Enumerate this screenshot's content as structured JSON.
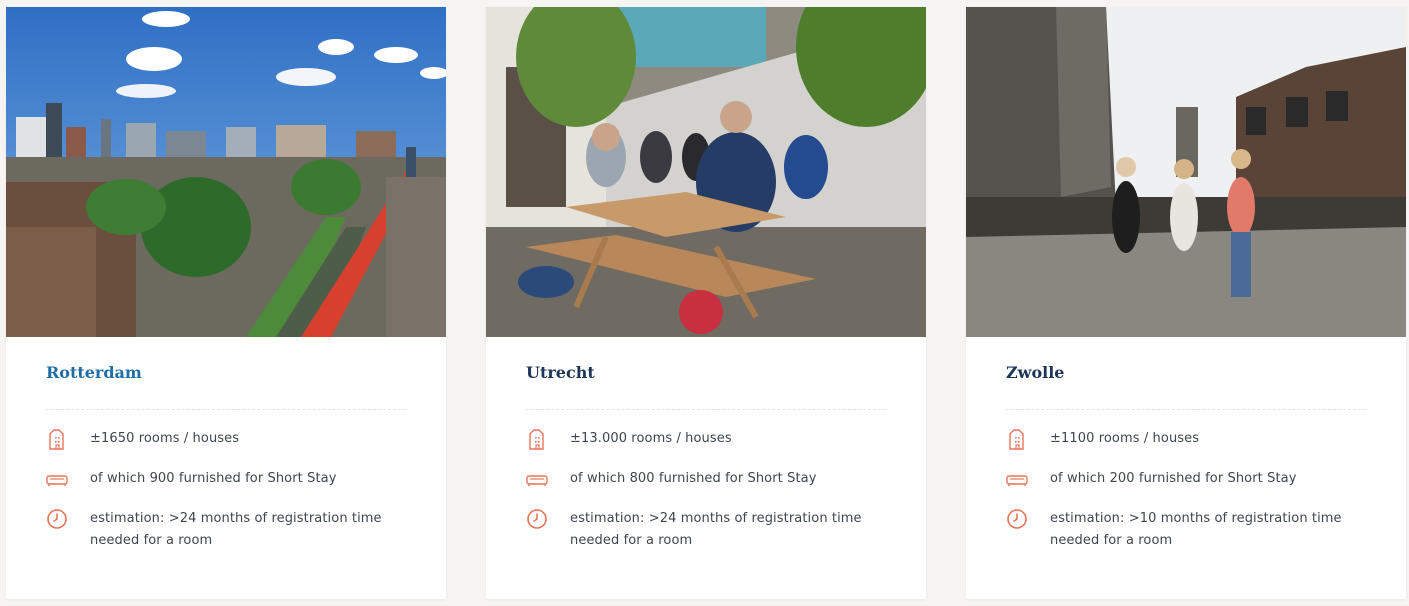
{
  "colors": {
    "accent": "#e8745a",
    "title": "#1d3556",
    "link_hover": "#1f6ea6"
  },
  "cities": [
    {
      "name": "Rotterdam",
      "photo_alt": "Rotterdam",
      "features": [
        {
          "icon": "building-icon",
          "text": "±1650 rooms / houses"
        },
        {
          "icon": "sofa-icon",
          "text": "of which 900 furnished for Short Stay"
        },
        {
          "icon": "clock-icon",
          "text": "estimation: >24 months of registration time needed for a room"
        }
      ]
    },
    {
      "name": "Utrecht",
      "photo_alt": "Utrecht",
      "features": [
        {
          "icon": "building-icon",
          "text": "±13.000 rooms / houses"
        },
        {
          "icon": "sofa-icon",
          "text": "of which 800 furnished for Short Stay"
        },
        {
          "icon": "clock-icon",
          "text": "estimation: >24 months of registration time needed for a room"
        }
      ]
    },
    {
      "name": "Zwolle",
      "photo_alt": "Zwolle",
      "features": [
        {
          "icon": "building-icon",
          "text": "±1100 rooms / houses"
        },
        {
          "icon": "sofa-icon",
          "text": "of which 200 furnished for Short Stay"
        },
        {
          "icon": "clock-icon",
          "text": "estimation: >10 months of registration time needed for a room"
        }
      ]
    }
  ]
}
